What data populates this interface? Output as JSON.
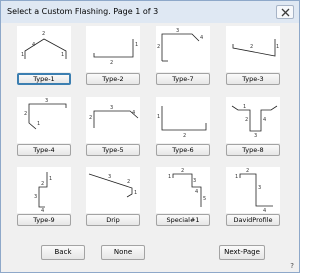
{
  "window": {
    "title": "Select a Custom Flashing.  Page 1 of 3"
  },
  "tiles": [
    {
      "label": "Type-1",
      "selected": true
    },
    {
      "label": "Type-2",
      "selected": false
    },
    {
      "label": "Type-7",
      "selected": false
    },
    {
      "label": "Type-3",
      "selected": false
    },
    {
      "label": "Type-4",
      "selected": false
    },
    {
      "label": "Type-5",
      "selected": false
    },
    {
      "label": "Type-6",
      "selected": false
    },
    {
      "label": "Type-8",
      "selected": false
    },
    {
      "label": "Type-9",
      "selected": false
    },
    {
      "label": "Drip",
      "selected": false
    },
    {
      "label": "Special#1",
      "selected": false
    },
    {
      "label": "DavidProfile",
      "selected": false
    }
  ],
  "actions": {
    "back": "Back",
    "none": "None",
    "next": "Next-Page"
  },
  "help_label": "?"
}
